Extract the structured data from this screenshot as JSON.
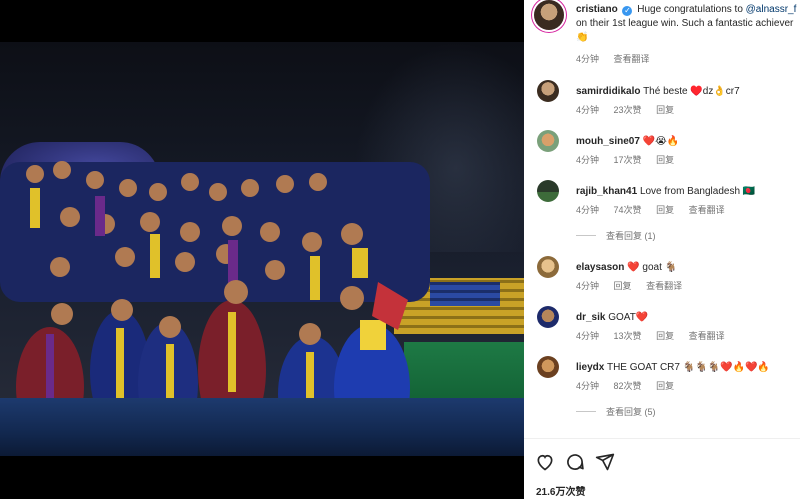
{
  "caption": {
    "username": "cristiano",
    "line1": "Huge congratulations to ",
    "mention": "@alnassr_f",
    "line2": "on their 1st league win. Such a fantastic achiever",
    "emoji": "👏",
    "time": "4分钟",
    "translate": "查看翻译"
  },
  "comments": [
    {
      "username": "samirdidikalo",
      "text": "Thé beste ♥️dz👌cr7",
      "time": "4分钟",
      "likes": "23次赞",
      "reply": "回复",
      "avatar_color": "#3b2c20"
    },
    {
      "username": "mouh_sine07",
      "text": "❤️😭🔥",
      "time": "4分钟",
      "likes": "17次赞",
      "reply": "回复",
      "avatar_color": "#7aa07a"
    },
    {
      "username": "rajib_khan41",
      "text": "Love from Bangladesh 🇧🇩",
      "time": "4分钟",
      "likes": "74次赞",
      "reply": "回复",
      "translate": "查看翻译",
      "avatar_color": "#2a3a2a",
      "view_replies": "查看回复 (1)"
    },
    {
      "username": "elaysason",
      "text": "❤️ goat 🐐",
      "time": "4分钟",
      "likes": "",
      "reply": "回复",
      "translate": "查看翻译",
      "avatar_color": "#c0a070"
    },
    {
      "username": "dr_sik",
      "text": "GOAT❤️",
      "time": "4分钟",
      "likes": "13次赞",
      "reply": "回复",
      "translate": "查看翻译",
      "avatar_color": "#1d2a6a"
    },
    {
      "username": "lieydx",
      "text": "THE GOAT CR7 🐐🐐🐐❤️🔥❤️🔥",
      "time": "4分钟",
      "likes": "82次赞",
      "reply": "回复",
      "avatar_color": "#6b4020",
      "view_replies": "查看回复 (5)"
    }
  ],
  "actions": {
    "like_icon": "heart-icon",
    "comment_icon": "comment-icon",
    "share_icon": "share-icon",
    "likes_count": "21.6万次赞"
  },
  "colors": {
    "verified": "#3897f0",
    "mention": "#00376b",
    "meta": "#737373",
    "heart": "#ed4956"
  }
}
